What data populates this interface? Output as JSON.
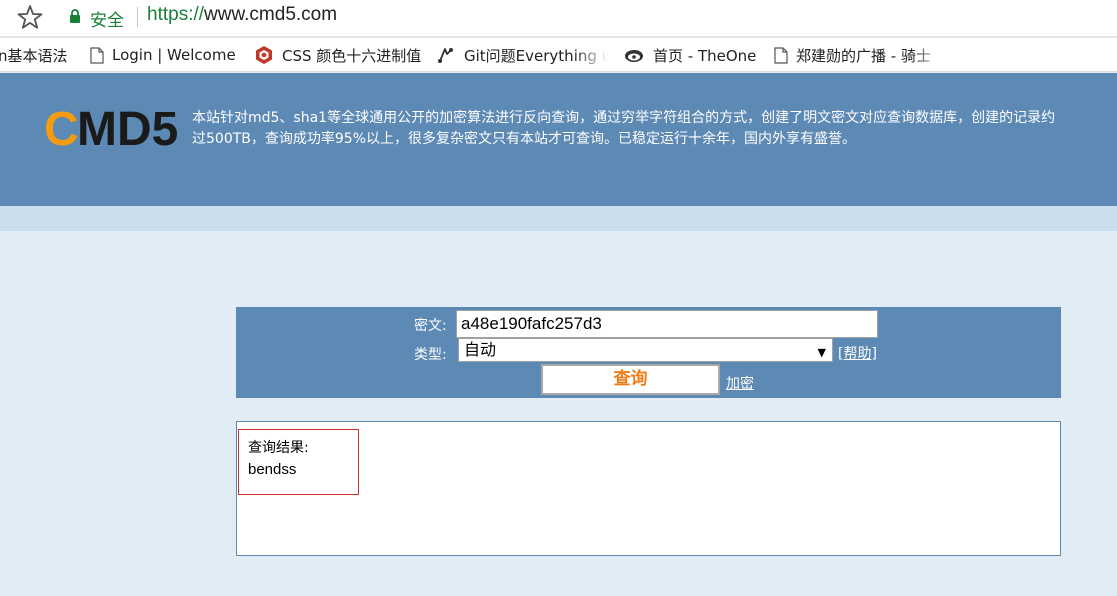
{
  "browser": {
    "secure_label": "安全",
    "url_scheme": "https://",
    "url_host": "www.cmd5.com",
    "bookmarks": [
      {
        "label": "n基本语法",
        "icon": "none"
      },
      {
        "label": "Login | Welcome",
        "icon": "page-icon"
      },
      {
        "label": "CSS 颜色十六进制值",
        "icon": "css-logo-icon"
      },
      {
        "label": "Git问题Everything u",
        "icon": "git-icon"
      },
      {
        "label": "首页 - TheOne",
        "icon": "bird-icon"
      },
      {
        "label": "郑建勋的广播 - 骑士",
        "icon": "page-icon"
      }
    ]
  },
  "header": {
    "logo_text": "CMD5",
    "logo_colors": {
      "c": "#f39c12",
      "rest": "#1a1a1a"
    },
    "description_line1": "本站针对md5、sha1等全球通用公开的加密算法进行反向查询，通过穷举字符组合的方式，创建了明文密文对应查询数据库，创建的记录约",
    "description_line2": "过500TB，查询成功率95%以上，很多复杂密文只有本站才可查询。已稳定运行十余年，国内外享有盛誉。"
  },
  "query": {
    "cipher_label": "密文:",
    "cipher_value": "a48e190fafc257d3",
    "type_label": "类型:",
    "type_value": "自动",
    "help_label": "帮助",
    "submit_label": "查询",
    "encrypt_label": "加密"
  },
  "result": {
    "label": "查询结果:",
    "value": "bendss"
  },
  "colors": {
    "header_bg": "#5d89b5",
    "page_bg": "#e1ecf5",
    "strip_bg": "#c9ddec",
    "submit_text": "#f07d1a",
    "result_border": "#d03030"
  }
}
